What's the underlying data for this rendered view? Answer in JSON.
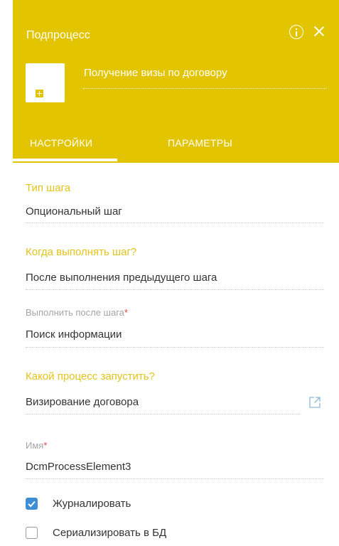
{
  "header": {
    "title": "Подпроцесс",
    "element_caption": "Получение визы по договору"
  },
  "tabs": [
    {
      "label": "НАСТРОЙКИ",
      "active": true
    },
    {
      "label": "ПАРАМЕТРЫ",
      "active": false
    }
  ],
  "fields": {
    "step_type": {
      "label": "Тип шага",
      "value": "Опциональный шаг"
    },
    "when_execute": {
      "label": "Когда выполнять шаг?",
      "value": "После выполнения предыдущего шага"
    },
    "execute_after": {
      "label": "Выполнить после шага",
      "required_mark": "*",
      "value": "Поиск информации"
    },
    "process_to_run": {
      "label": "Какой процесс запустить?",
      "value": "Визирование договора"
    },
    "name": {
      "label": "Имя",
      "required_mark": "*",
      "value": "DcmProcessElement3"
    }
  },
  "checkboxes": [
    {
      "label": "Журналировать",
      "checked": true
    },
    {
      "label": "Сериализировать в БД",
      "checked": false
    }
  ],
  "colors": {
    "header_bg": "#e3c400",
    "section_label": "#e4c31a",
    "required": "#ea4335",
    "checkbox_checked": "#3d8ed7"
  },
  "icons": [
    "info-icon",
    "close-icon",
    "add-element-icon",
    "open-link-icon",
    "checkmark-icon"
  ]
}
